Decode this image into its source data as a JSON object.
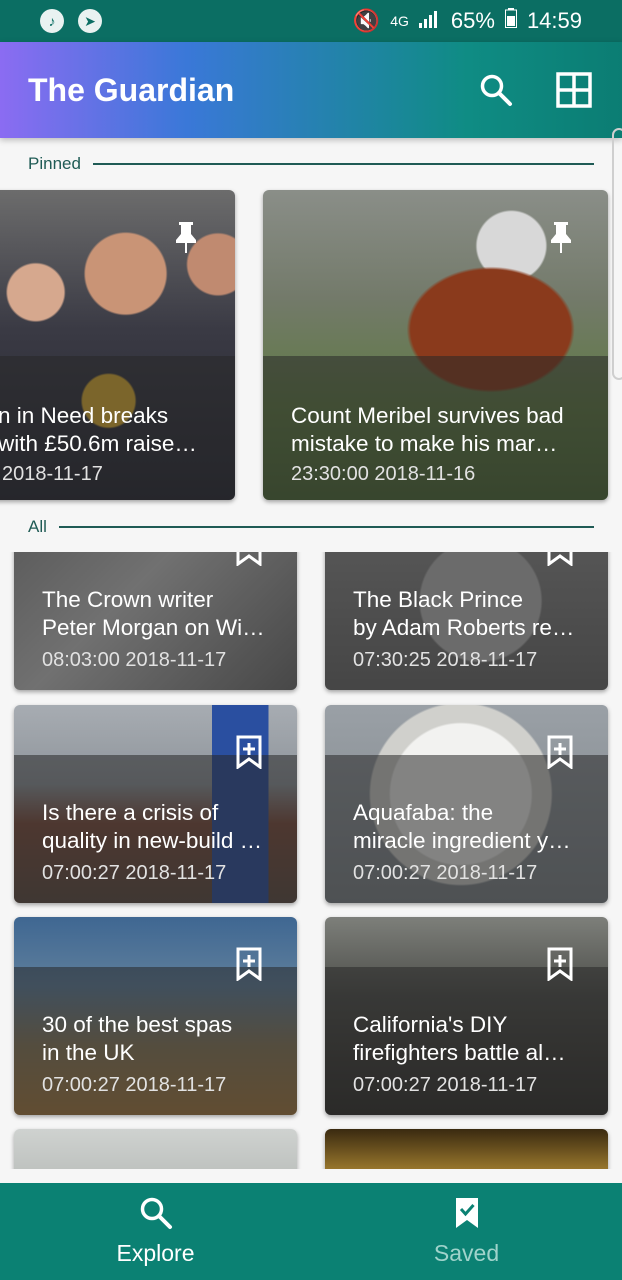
{
  "status_bar": {
    "network": "4G",
    "battery": "65%",
    "time": "14:59"
  },
  "app_bar": {
    "title": "The Guardian",
    "icons": [
      "search-icon",
      "grid-view-icon"
    ]
  },
  "sections": {
    "pinned_label": "Pinned",
    "all_label": "All"
  },
  "pinned": [
    {
      "title": "n in Need breaks\nwith £50.6m raise…",
      "time": "2018-11-17",
      "icon": "pin-icon"
    },
    {
      "title": "Count Meribel survives bad\nmistake to make his mar…",
      "time": "23:30:00 2018-11-16",
      "icon": "pin-icon"
    }
  ],
  "articles": [
    {
      "title": "The Crown writer\nPeter Morgan on Wi…",
      "time": "08:03:00 2018-11-17",
      "icon": "bookmark-add-icon"
    },
    {
      "title": "The Black Prince\nby Adam Roberts re…",
      "time": "07:30:25 2018-11-17",
      "icon": "bookmark-add-icon"
    },
    {
      "title": "Is there a crisis of\nquality in new-build …",
      "time": "07:00:27 2018-11-17",
      "icon": "bookmark-add-icon"
    },
    {
      "title": "Aquafaba: the\nmiracle ingredient y…",
      "time": "07:00:27 2018-11-17",
      "icon": "bookmark-add-icon"
    },
    {
      "title": "30 of the best spas\nin the UK",
      "time": "07:00:27 2018-11-17",
      "icon": "bookmark-add-icon"
    },
    {
      "title": "California's DIY\nfirefighters battle al…",
      "time": "07:00:27 2018-11-17",
      "icon": "bookmark-add-icon"
    }
  ],
  "bottom_nav": {
    "explore_label": "Explore",
    "saved_label": "Saved"
  },
  "colors": {
    "status_bar": "#0b6e63",
    "bottom_nav": "#0b8173",
    "accent_line": "#1f5b55"
  }
}
